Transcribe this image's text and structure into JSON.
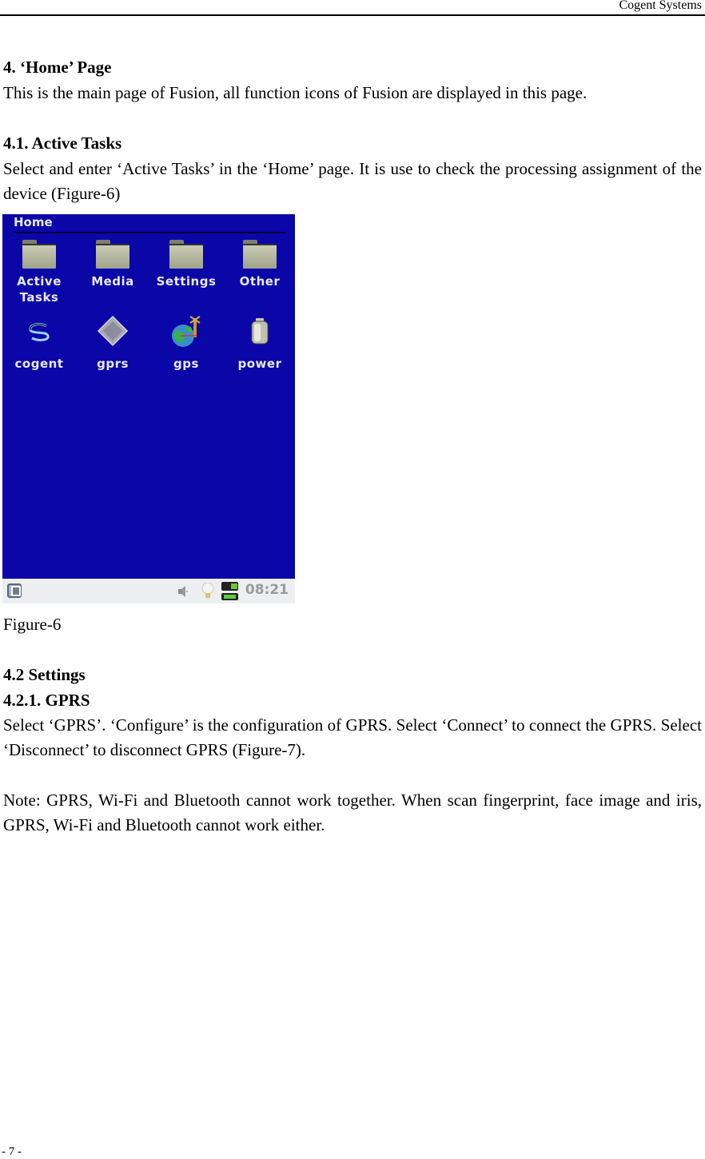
{
  "header": {
    "running_title": "Cogent Systems"
  },
  "sections": {
    "s4_heading": "4. ‘Home’ Page",
    "s4_body": "This is the main page of Fusion, all function icons of Fusion are displayed in this page.",
    "s41_heading": "4.1. Active Tasks",
    "s41_body": "Select and enter ‘Active Tasks’ in the ‘Home’ page. It is use to check the processing assignment of the device (Figure-6)",
    "figure_caption": "Figure-6",
    "s42_heading": "4.2 Settings",
    "s421_heading": "4.2.1. GPRS",
    "s421_body": "Select ‘GPRS’. ‘Configure’ is the configuration of GPRS. Select ‘Connect’ to connect the GPRS. Select ‘Disconnect’ to disconnect GPRS (Figure-7).",
    "note_body": "Note: GPRS, Wi-Fi and Bluetooth cannot work together. When scan fingerprint, face image and iris, GPRS, Wi-Fi and Bluetooth cannot work either."
  },
  "device_screen": {
    "title": "Home",
    "background_color": "#0b06a8",
    "tiles": [
      {
        "label": "Active Tasks",
        "icon": "folder-icon"
      },
      {
        "label": "Media",
        "icon": "folder-icon"
      },
      {
        "label": "Settings",
        "icon": "folder-icon"
      },
      {
        "label": "Other",
        "icon": "folder-icon"
      },
      {
        "label": "cogent",
        "icon": "cogent-logo-icon"
      },
      {
        "label": "gprs",
        "icon": "gprs-diamond-icon"
      },
      {
        "label": "gps",
        "icon": "globe-satellite-icon"
      },
      {
        "label": "power",
        "icon": "battery-icon"
      }
    ],
    "taskbar": {
      "clock": "08:21",
      "icons": [
        "launcher-icon",
        "volume-icon",
        "light-bulb-icon",
        "battery-status-icon"
      ]
    }
  },
  "footer": {
    "page_number": "- 7 -"
  }
}
